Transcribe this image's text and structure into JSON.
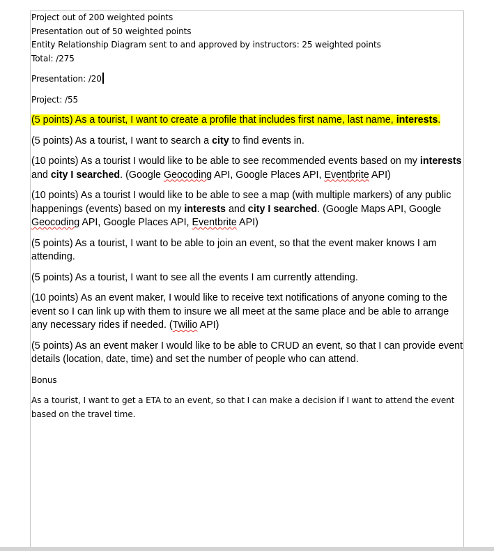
{
  "scores": {
    "line1": "Project out of 200 weighted points",
    "line2": "Presentation out of 50 weighted points",
    "line3": "Entity Relationship Diagram sent to and approved by instructors: 25 weighted points",
    "line4": "Total: /275"
  },
  "presentation_score": "Presentation: /20",
  "project_score": "Project: /55",
  "stories": {
    "s1": {
      "a": "(5 points) As a tourist, I want to create a profile that includes first name, last name,",
      "b": "interests",
      "c": "."
    },
    "s2": {
      "a": "(5 points) As a tourist, I want to search a ",
      "b": "city",
      "c": " to find events in."
    },
    "s3": {
      "a": "(10 points) As a tourist I would like to be able to see recommended events based on my ",
      "b": "interests",
      "c": " and ",
      "d": "city I searched",
      "e": ". (Google ",
      "f": "Geocoding",
      "g": " API, Google Places API, ",
      "h": "Eventbrite",
      "i": " API)"
    },
    "s4": {
      "a": "(10 points) As a tourist I would like to be able to see a map (with multiple markers) of any public happenings (events) based on my ",
      "b": "interests",
      "c": " and ",
      "d": "city I searched",
      "e": ". (Google Maps API, Google ",
      "f": "Geocoding",
      "g": " API, Google Places API, ",
      "h": "Eventbrite",
      "i": " API)"
    },
    "s5": "(5 points) As a tourist, I want to be able to join an event, so that the event maker knows I am attending.",
    "s6": "(5 points) As a tourist, I want to see all the events I am currently attending.",
    "s7": {
      "a": "(10 points) As an event maker, I would like to receive text notifications of anyone coming to the event so I can link up with them to insure we all meet at the same place and be able to arrange any necessary rides if needed. (",
      "b": "Twilio",
      "c": " API)"
    },
    "s8": "(5 points) As an event maker I would like to be able to CRUD an event, so that I can provide event details (location, date, time) and set the number of people who can attend."
  },
  "bonus": {
    "heading": "Bonus",
    "text": "As a tourist, I want to get a ETA to an event, so that I can make a decision if I want to attend the event based on the travel time."
  }
}
